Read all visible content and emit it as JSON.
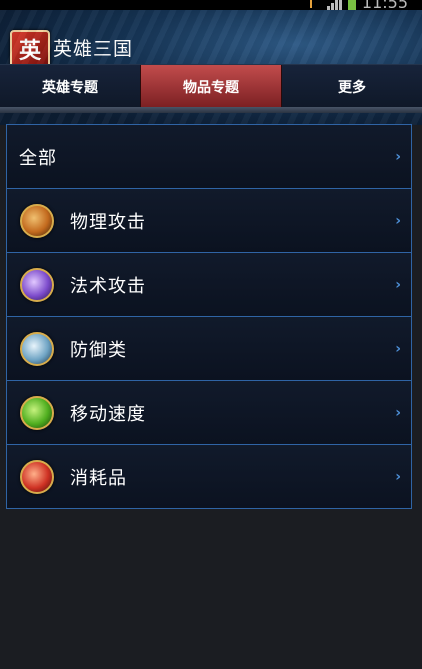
{
  "status": {
    "time": "11:55"
  },
  "app": {
    "logo_char": "英",
    "title": "英雄三国"
  },
  "tabs": [
    {
      "label": "英雄专题",
      "active": false
    },
    {
      "label": "物品专题",
      "active": true
    },
    {
      "label": "更多",
      "active": false
    }
  ],
  "menu": {
    "items": [
      {
        "label": "全部",
        "icon": null
      },
      {
        "label": "物理攻击",
        "icon": "sword-icon",
        "color": "#d98a3a"
      },
      {
        "label": "法术攻击",
        "icon": "magic-orb-icon",
        "color": "#8a5bd0"
      },
      {
        "label": "防御类",
        "icon": "shield-icon",
        "color": "#6fa4c4"
      },
      {
        "label": "移动速度",
        "icon": "boots-icon",
        "color": "#5fbf2e"
      },
      {
        "label": "消耗品",
        "icon": "potion-icon",
        "color": "#d23b2b"
      }
    ],
    "chevron": "›"
  },
  "colors": {
    "accent_border": "#2f64a5",
    "active_tab": "#a8353a",
    "icon_ring": "#d7ac4c"
  }
}
